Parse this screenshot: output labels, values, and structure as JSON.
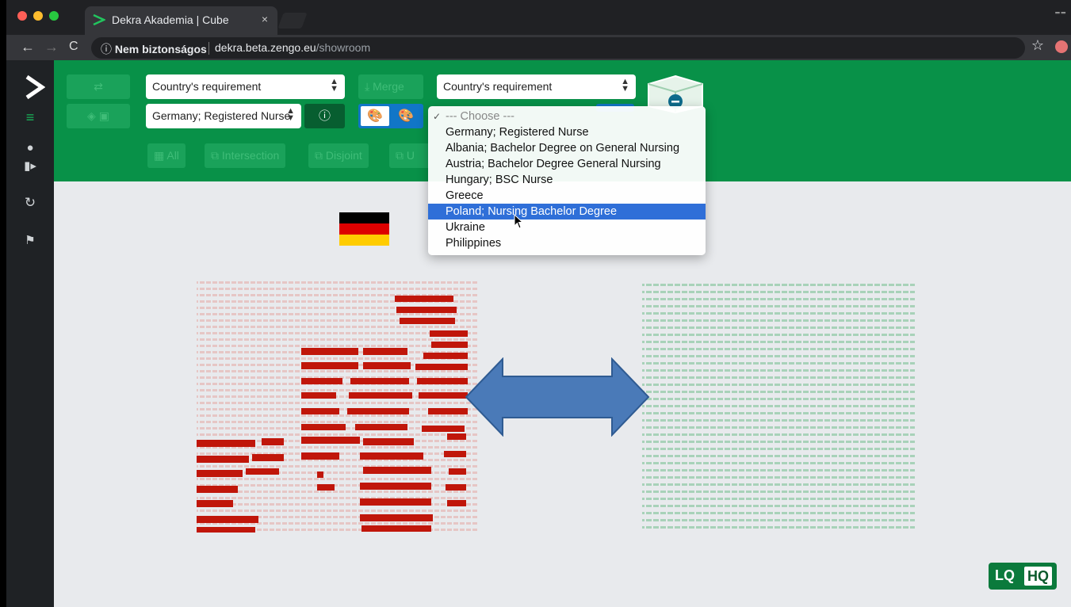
{
  "browser": {
    "tab_title": "Dekra Akademia | Cube",
    "tab_close": "×",
    "security_label": "Nem biztonságos",
    "url_host": "dekra.beta.zengo.eu",
    "url_path": "/showroom"
  },
  "sidebar": {
    "items": [
      "logo",
      "menu-icon",
      "user-icon",
      "logout-icon",
      "refresh-icon",
      "flag-icon"
    ]
  },
  "toolbar": {
    "left_type_select": "Country's requirement",
    "left_item_select": "Germany; Registered Nurse",
    "merge_label": "Merge",
    "right_type_select": "Country's requirement",
    "filters": [
      "All",
      "Intersection",
      "Disjoint",
      "U"
    ]
  },
  "dropdown": {
    "options": [
      "--- Choose ---",
      "Germany; Registered Nurse",
      "Albania; Bachelor Degree on General Nursing",
      "Austria; Bachelor Degree General Nursing",
      "Hungary; BSC Nurse",
      "Greece",
      "Poland; Nursing Bachelor Degree",
      "Ukraine",
      "Philippines"
    ],
    "checked": "--- Choose ---",
    "highlighted": "Poland; Nursing Bachelor Degree"
  },
  "badge": {
    "lq": "LQ",
    "hq": "HQ"
  },
  "colors": {
    "toolbar_green": "#089148",
    "left_cube": "#c0160a",
    "right_cube": "#1e8a4a",
    "arrow": "#4a7ab8",
    "highlight": "#2f6fd8"
  }
}
